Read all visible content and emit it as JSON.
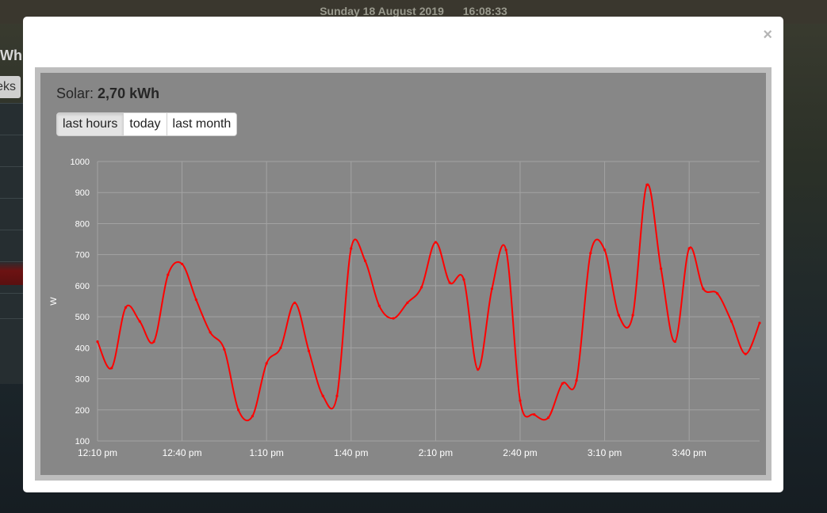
{
  "header": {
    "date": "Sunday 18 August 2019",
    "time": "16:08:33"
  },
  "background": {
    "unit_fragment": "Wh",
    "button_fragment": "eks"
  },
  "modal": {
    "close_label": "×"
  },
  "panel": {
    "title_label": "Solar:",
    "title_value": "2,70 kWh",
    "buttons": [
      "last hours",
      "today",
      "last month"
    ],
    "active_button": "last hours"
  },
  "colors": {
    "line": "#ff0000",
    "grid": "#a3a3a3",
    "panel_bg": "#878787",
    "text": "#ffffff"
  },
  "chart_data": {
    "type": "line",
    "ylabel": "W",
    "xlabel": "",
    "ylim": [
      100,
      1000
    ],
    "yticks": [
      100,
      200,
      300,
      400,
      500,
      600,
      700,
      800,
      900,
      1000
    ],
    "xlim_minutes": [
      0,
      235
    ],
    "xticks": [
      {
        "label": "12:10 pm",
        "min": 0
      },
      {
        "label": "12:40 pm",
        "min": 30
      },
      {
        "label": "1:10 pm",
        "min": 60
      },
      {
        "label": "1:40 pm",
        "min": 90
      },
      {
        "label": "2:10 pm",
        "min": 120
      },
      {
        "label": "2:40 pm",
        "min": 150
      },
      {
        "label": "3:10 pm",
        "min": 180
      },
      {
        "label": "3:40 pm",
        "min": 210
      }
    ],
    "grid": true,
    "legend": "none",
    "series": [
      {
        "points": [
          [
            0,
            420
          ],
          [
            5,
            335
          ],
          [
            10,
            530
          ],
          [
            15,
            485
          ],
          [
            20,
            420
          ],
          [
            25,
            635
          ],
          [
            30,
            670
          ],
          [
            35,
            555
          ],
          [
            40,
            450
          ],
          [
            45,
            395
          ],
          [
            50,
            200
          ],
          [
            55,
            180
          ],
          [
            60,
            350
          ],
          [
            65,
            400
          ],
          [
            70,
            545
          ],
          [
            75,
            390
          ],
          [
            80,
            245
          ],
          [
            85,
            245
          ],
          [
            90,
            720
          ],
          [
            95,
            680
          ],
          [
            100,
            535
          ],
          [
            105,
            495
          ],
          [
            110,
            545
          ],
          [
            115,
            595
          ],
          [
            120,
            740
          ],
          [
            125,
            610
          ],
          [
            130,
            620
          ],
          [
            135,
            330
          ],
          [
            140,
            590
          ],
          [
            145,
            715
          ],
          [
            150,
            230
          ],
          [
            155,
            185
          ],
          [
            160,
            175
          ],
          [
            165,
            285
          ],
          [
            170,
            295
          ],
          [
            175,
            705
          ],
          [
            180,
            715
          ],
          [
            185,
            505
          ],
          [
            190,
            505
          ],
          [
            195,
            925
          ],
          [
            200,
            655
          ],
          [
            205,
            420
          ],
          [
            210,
            720
          ],
          [
            215,
            590
          ],
          [
            220,
            575
          ],
          [
            225,
            485
          ],
          [
            230,
            380
          ],
          [
            235,
            480
          ]
        ]
      }
    ]
  }
}
